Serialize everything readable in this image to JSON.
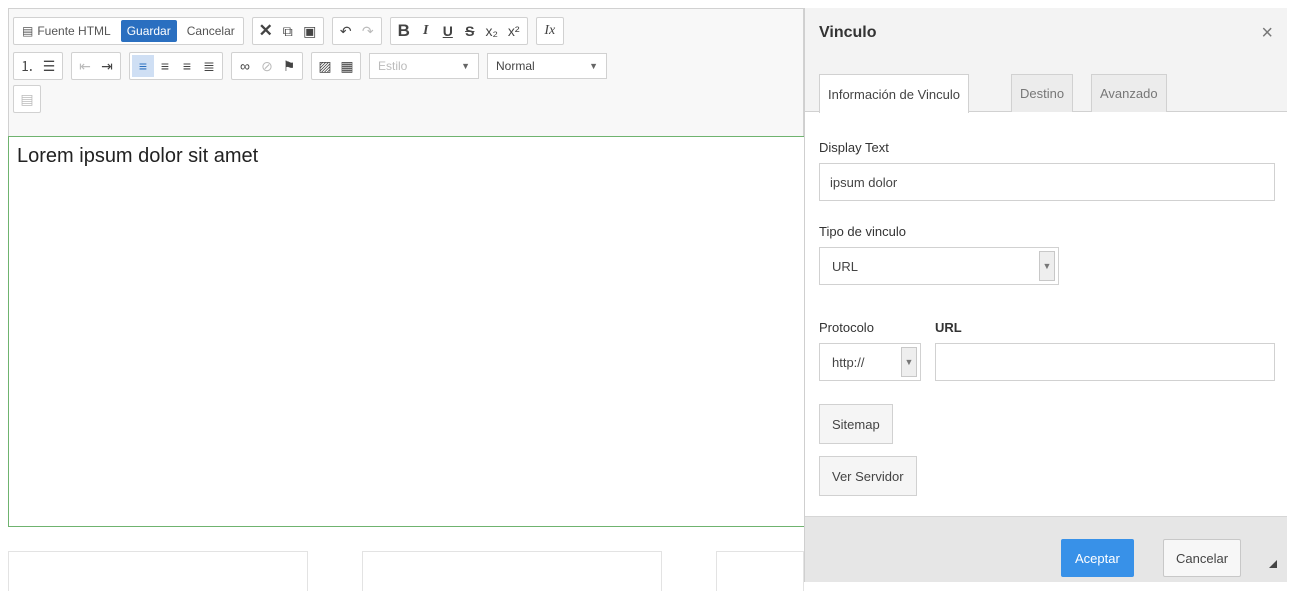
{
  "toolbar": {
    "source_label": "Fuente HTML",
    "save_label": "Guardar",
    "cancel_label": "Cancelar",
    "style_placeholder": "Estilo",
    "format_value": "Normal"
  },
  "editor": {
    "content": "Lorem ipsum dolor sit amet"
  },
  "dialog": {
    "title": "Vinculo",
    "close_icon": "×",
    "tabs": [
      "Información de Vinculo",
      "Destino",
      "Avanzado"
    ],
    "display_text_label": "Display Text",
    "display_text_value": "ipsum dolor",
    "link_type_label": "Tipo de vinculo",
    "link_type_value": "URL",
    "protocol_label": "Protocolo",
    "protocol_value": "http://",
    "url_label": "URL",
    "url_value": "",
    "sitemap_label": "Sitemap",
    "server_label": "Ver Servidor",
    "ok_label": "Aceptar",
    "cancel_label": "Cancelar"
  },
  "colors": {
    "primary": "#2a6fc0",
    "ok": "#3891e8",
    "focus_border": "#6fb36f"
  }
}
